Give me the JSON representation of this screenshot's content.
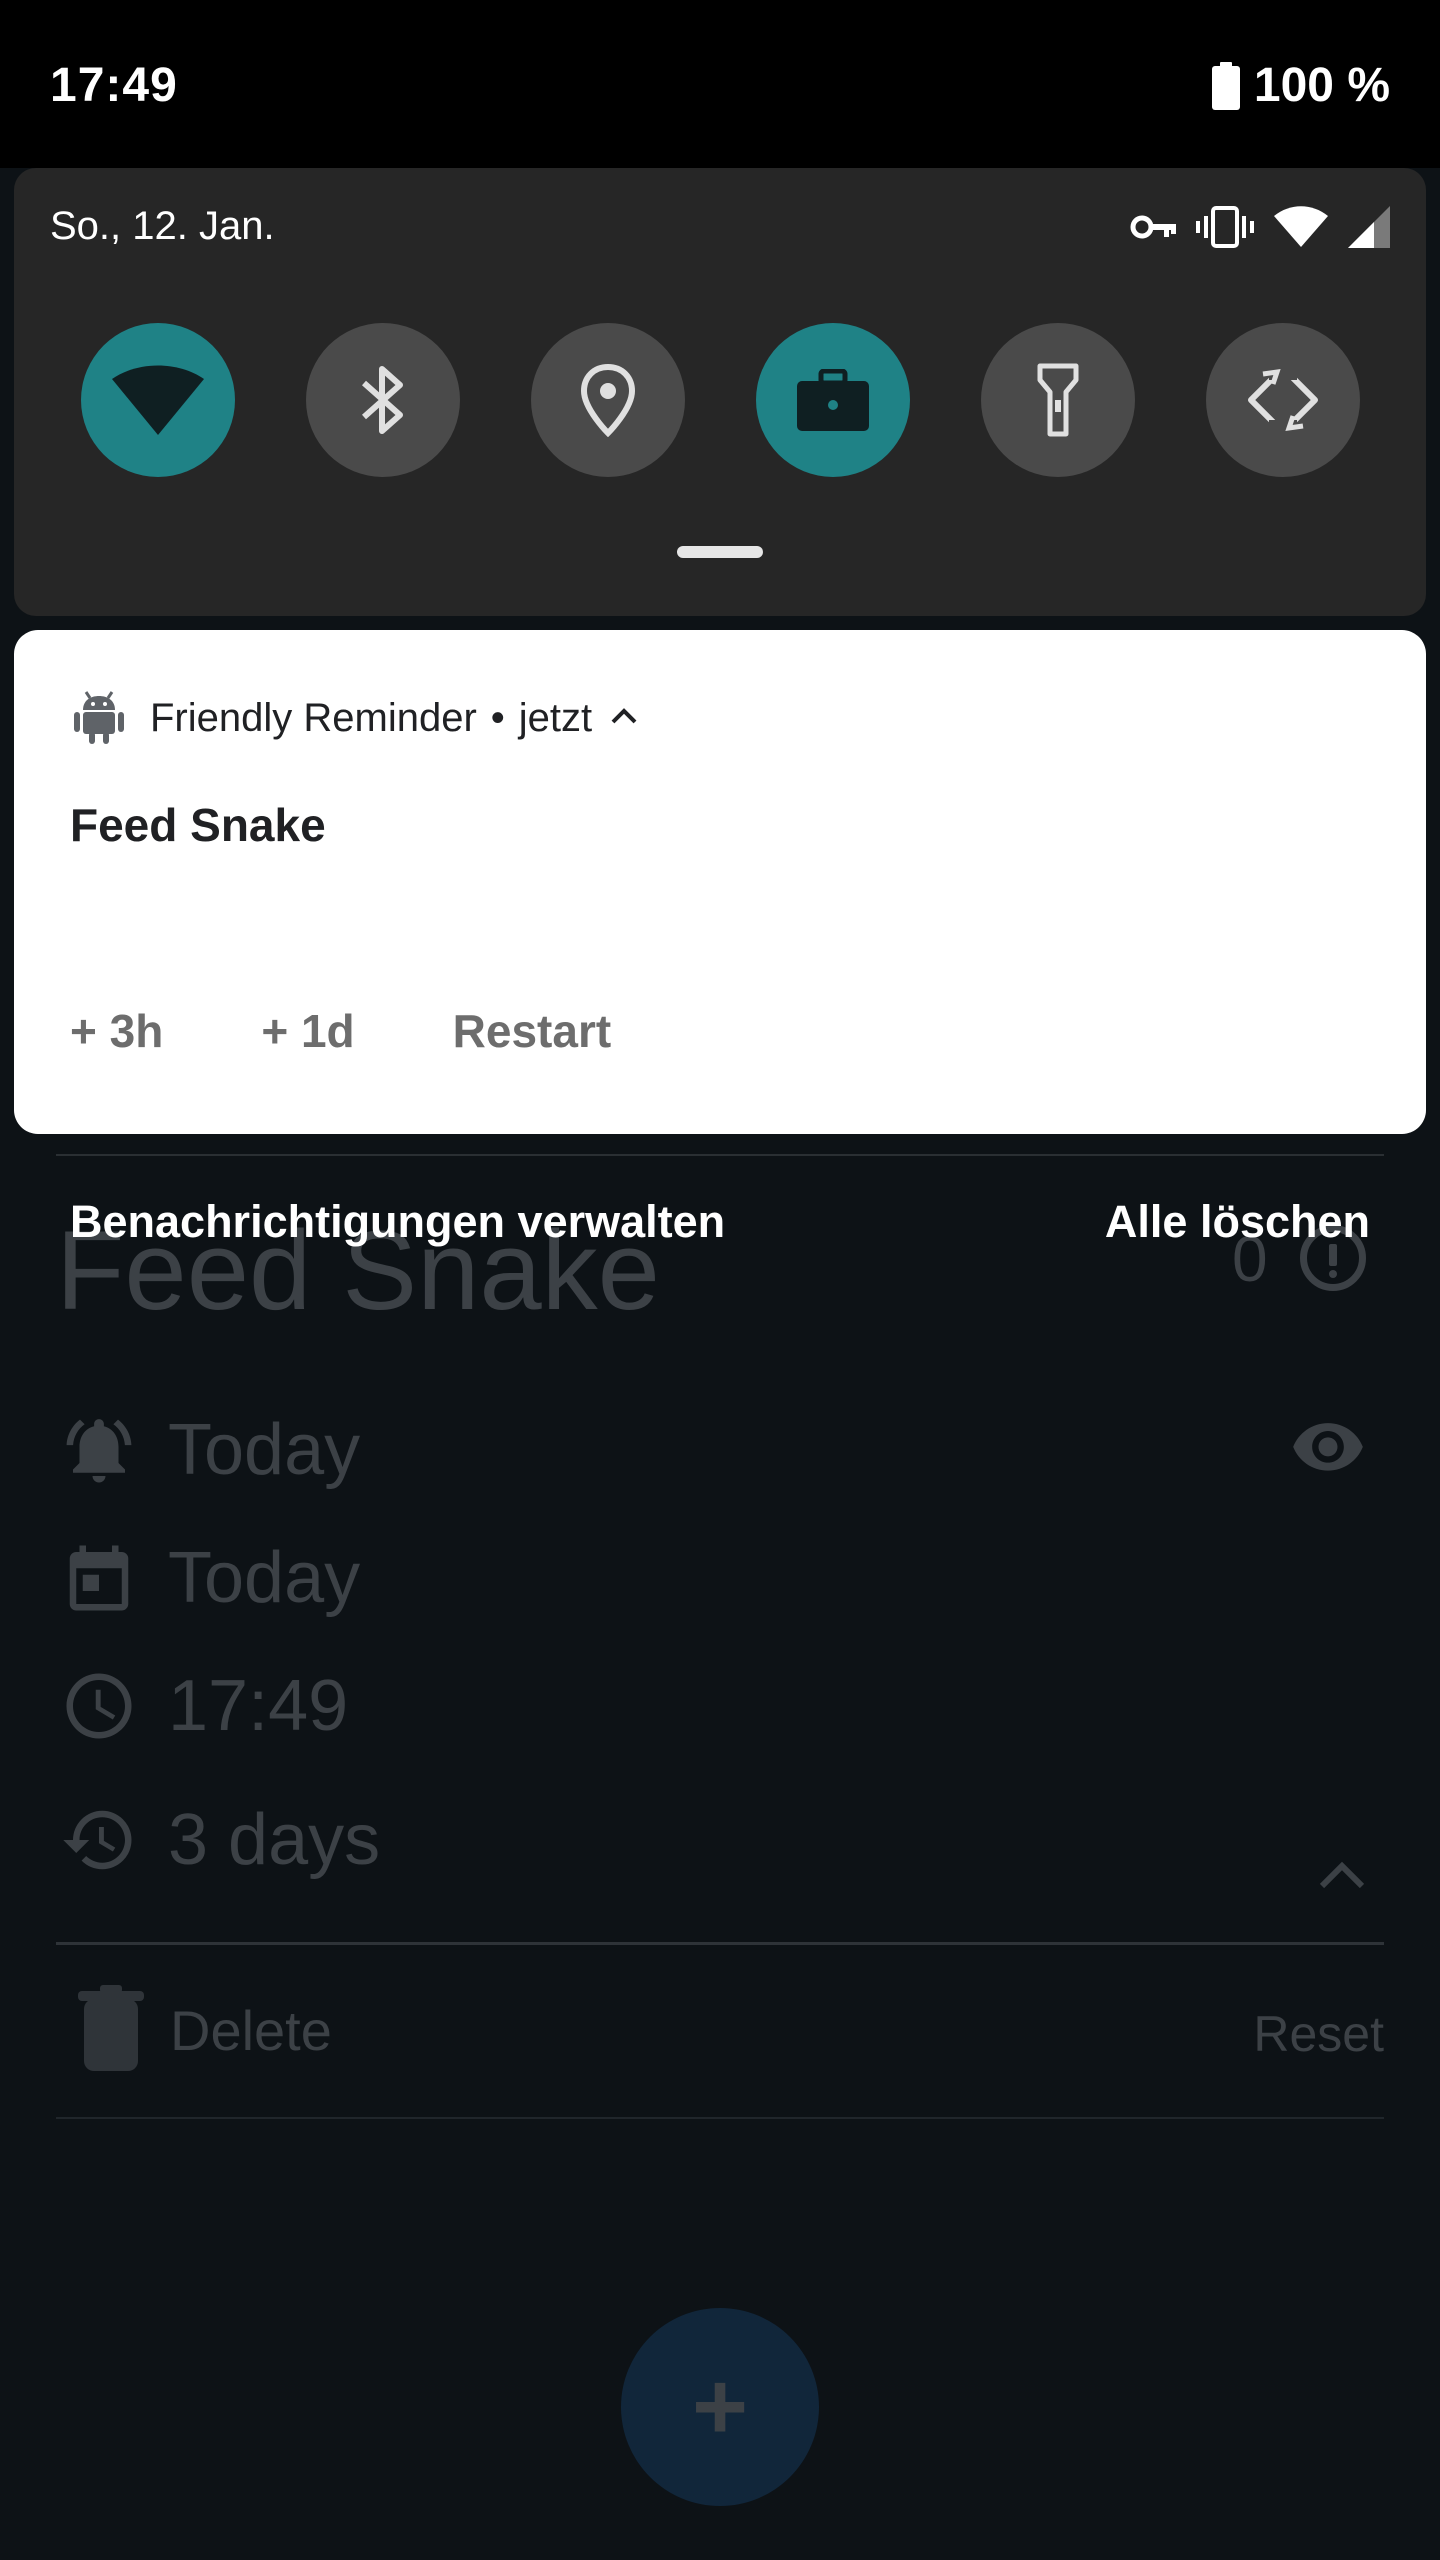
{
  "status_bar": {
    "time": "17:49",
    "battery_percent": "100 %",
    "battery_icon": "battery-full-icon"
  },
  "quick_settings": {
    "date": "So., 12. Jan.",
    "status_icons": [
      "vpn-key-icon",
      "vibrate-icon",
      "wifi-signal-icon",
      "cell-signal-icon"
    ],
    "tiles": [
      {
        "name": "wifi",
        "icon": "wifi-icon",
        "active": true
      },
      {
        "name": "bluetooth",
        "icon": "bluetooth-icon",
        "active": false
      },
      {
        "name": "location",
        "icon": "location-icon",
        "active": false
      },
      {
        "name": "work-profile",
        "icon": "briefcase-icon",
        "active": true
      },
      {
        "name": "flashlight",
        "icon": "flashlight-icon",
        "active": false
      },
      {
        "name": "auto-rotate",
        "icon": "rotate-icon",
        "active": false
      }
    ],
    "accent_color": "#1f8286"
  },
  "notification": {
    "app_name": "Friendly Reminder",
    "separator": "•",
    "time": "jetzt",
    "title": "Feed Snake",
    "actions": [
      "+ 3h",
      "+ 1d",
      "Restart"
    ]
  },
  "shade_footer": {
    "manage_label": "Benachrichtigungen verwalten",
    "clear_all_label": "Alle löschen"
  },
  "app": {
    "title": "Feed Snake",
    "counter": "0",
    "rows": {
      "alarm": "Today",
      "date": "Today",
      "time": "17:49",
      "repeat": "3 days"
    },
    "delete_label": "Delete",
    "reset_label": "Reset",
    "fab_label": "+"
  }
}
